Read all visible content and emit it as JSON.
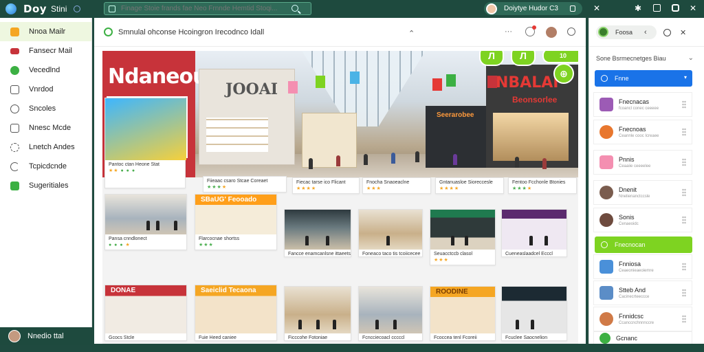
{
  "app": {
    "brand": "Doy",
    "brand_sub": "Stini",
    "search_placeholder": "Finage Stoie frands fae Neo Frnnde Hemtid Stoqi..."
  },
  "user": {
    "name": "Doiytye Hudor C3"
  },
  "sidebar": {
    "items": [
      {
        "label": "Nnoa Mailr",
        "color": "#f5a623"
      },
      {
        "label": "Fansecr Mail",
        "color": "#c7333a"
      },
      {
        "label": "Vecedlnd",
        "color": "#3cb043"
      },
      {
        "label": "Vnrdod",
        "color": "#555555"
      },
      {
        "label": "Sncoles",
        "color": "#555555"
      },
      {
        "label": "Nnesc Mcde",
        "color": "#555555"
      },
      {
        "label": "Lnetch Andes",
        "color": "#555555"
      },
      {
        "label": "Tcpicdcnde",
        "color": "#555555"
      },
      {
        "label": "Sugeritiales",
        "color": "#3cb043"
      }
    ],
    "footer_user": "Nnedio ttal"
  },
  "main": {
    "title": "Smnulal ohconse Hcoingron Irecodnco Idall",
    "hero": {
      "sign_left": "Ndaneou",
      "sign_mid": "JOOAI",
      "sign_right": "NBALAI",
      "sign_right_sub": "Beonsorlee",
      "sign_inner": "Seerarobee",
      "badge": "10",
      "btn1": "Л",
      "btn2": "Л",
      "btn3": "⊕"
    },
    "cards": [
      {
        "caption": "Pantoc ctan Heone Stat",
        "sign": ""
      },
      {
        "caption": "Fiieaac csaro Stcae Coreaet",
        "sign": ""
      },
      {
        "caption": "Fiecac tarse ico Flicant",
        "sign": ""
      },
      {
        "caption": "Fnocha Snaoeaclne",
        "sign": ""
      },
      {
        "caption": "Gntanuasloe Sioreccesle",
        "sign": ""
      },
      {
        "caption": "Fentoo Fcchonle Btonies",
        "sign": ""
      },
      {
        "caption": "Pansa cnndlonect",
        "sign": ""
      },
      {
        "caption": "Flarcocnae shortss",
        "sign": "SBaUG' Feooado"
      },
      {
        "caption": "Fancce enamcanlsne ittaeets",
        "sign": ""
      },
      {
        "caption": "Foneaco taco tis tcoiicecee",
        "sign": ""
      },
      {
        "caption": "Seuacctccb clasol",
        "sign": ""
      },
      {
        "caption": "Cueneaslaadcel Ecccl",
        "sign": ""
      },
      {
        "caption": "Gcocs Stcle",
        "sign": "DONAE"
      },
      {
        "caption": "Fuie Heed caniee",
        "sign": "Saeiclid Tecaona"
      },
      {
        "caption": "Ficccohe Fotoniae",
        "sign": ""
      },
      {
        "caption": "Fcncciecoacl cccccl",
        "sign": ""
      },
      {
        "caption": "Fcoccea tenl Fcoreii",
        "sign": "ROODINE"
      },
      {
        "caption": "Fcuclee Saocnelion",
        "sign": ""
      }
    ]
  },
  "right": {
    "chip": "Foosa",
    "select": "Sone Bsrmecnetges Biau",
    "primary_button": "Fnne",
    "items": [
      {
        "title": "Fnecnacas",
        "sub": "fcoancl conec ceeeee",
        "color": "#9c5bb5"
      },
      {
        "title": "Fnecnoas",
        "sub": "Ceannle cooc Icreaee",
        "color": "#e8772e"
      },
      {
        "title": "Pnnis",
        "sub": "Ceaaiie ceeeelee",
        "color": "#f48fb1"
      },
      {
        "title": "Dnenit",
        "sub": "Nnelienanctccsle",
        "color": "#7a5c4e"
      },
      {
        "title": "Sonis",
        "sub": "Cenaeoidc",
        "color": "#6e4b3e"
      }
    ],
    "green_button": "Fnecnocan",
    "items2": [
      {
        "title": "Fnniosa",
        "sub": "Ceaeonieaeoiemre",
        "color": "#4a90d9"
      },
      {
        "title": "Stteb And",
        "sub": "Cacinecrteeccce",
        "color": "#5b8dc7"
      },
      {
        "title": "Fnnidcsc",
        "sub": "Ccanccnchnnnccre",
        "color": "#d07a47"
      },
      {
        "title": "Gcnanc",
        "sub": "Cnccs",
        "color": "#3cb043"
      }
    ]
  }
}
